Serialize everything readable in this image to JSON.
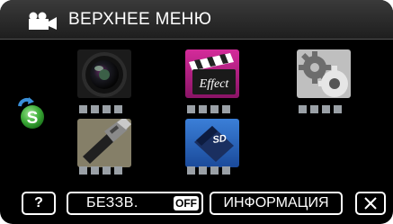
{
  "header": {
    "title": "ВЕРХНЕЕ МЕНЮ",
    "mode_icon": "video-camera-icon"
  },
  "menu_items": [
    {
      "icon": "camera-lens-icon",
      "page_dots": 4,
      "active_dot": null
    },
    {
      "icon": "effect-clapperboard-icon",
      "icon_text": "Effect",
      "page_dots": 4,
      "active_dot": null
    },
    {
      "icon": "gears-icon",
      "page_dots": 4,
      "active_dot": null
    },
    {
      "icon": "hdmi-cable-icon",
      "page_dots": 4,
      "active_dot": null
    },
    {
      "icon": "sd-card-icon",
      "icon_text": "SD",
      "page_dots": 4,
      "active_dot": null
    }
  ],
  "mode_switch": {
    "icon": "s-mode-switch-icon",
    "label": "S"
  },
  "footer": {
    "help_label": "?",
    "mute_label": "БЕЗЗВ.",
    "mute_state": "OFF",
    "info_label": "ИНФОРМАЦИЯ",
    "close_icon": "close-icon"
  },
  "colors": {
    "background": "#000000",
    "header": "#2a2a2a",
    "text": "#ffffff",
    "dot": "#9aa0a6",
    "effect_tile": "#c01f8a",
    "sd_tile": "#2f6fc4",
    "s_icon": "#3fae3a"
  }
}
